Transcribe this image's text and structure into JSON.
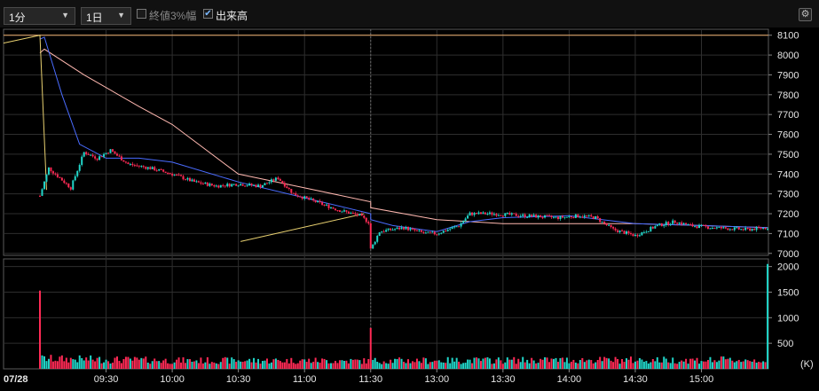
{
  "toolbar": {
    "interval": "1分",
    "period": "1日",
    "limit_label": "終値3%幅",
    "limit_checked": false,
    "volume_label": "出来高",
    "volume_checked": true,
    "gear_icon": "gear-icon"
  },
  "chart_data": {
    "type": "candlestick",
    "date_label": "07/28",
    "price_axis": {
      "ylim": [
        6990,
        8130
      ],
      "ticks": [
        7000,
        7100,
        7200,
        7300,
        7400,
        7500,
        7600,
        7700,
        7800,
        7900,
        8000,
        8100
      ]
    },
    "volume_axis": {
      "ylim": [
        0,
        2150
      ],
      "ticks": [
        500,
        1000,
        1500,
        2000
      ],
      "unit": "(K)"
    },
    "x_ticks": [
      "09:30",
      "10:00",
      "10:30",
      "11:00",
      "11:30",
      "13:00",
      "13:30",
      "14:00",
      "14:30",
      "15:00"
    ],
    "reference_line": 8100,
    "price_keypoints": [
      [
        "09:00",
        7290
      ],
      [
        "09:04",
        7430
      ],
      [
        "09:10",
        7370
      ],
      [
        "09:14",
        7330
      ],
      [
        "09:20",
        7510
      ],
      [
        "09:26",
        7480
      ],
      [
        "09:32",
        7520
      ],
      [
        "09:40",
        7450
      ],
      [
        "09:50",
        7430
      ],
      [
        "10:00",
        7400
      ],
      [
        "10:10",
        7360
      ],
      [
        "10:20",
        7340
      ],
      [
        "10:30",
        7350
      ],
      [
        "10:40",
        7340
      ],
      [
        "10:48",
        7380
      ],
      [
        "10:55",
        7300
      ],
      [
        "11:05",
        7260
      ],
      [
        "11:15",
        7220
      ],
      [
        "11:25",
        7190
      ],
      [
        "11:30",
        7150
      ],
      [
        "12:30",
        7020
      ],
      [
        "12:34",
        7110
      ],
      [
        "12:45",
        7130
      ],
      [
        "12:55",
        7100
      ],
      [
        "13:00",
        7100
      ],
      [
        "13:10",
        7140
      ],
      [
        "13:15",
        7200
      ],
      [
        "13:25",
        7200
      ],
      [
        "13:40",
        7190
      ],
      [
        "13:55",
        7180
      ],
      [
        "14:05",
        7190
      ],
      [
        "14:12",
        7180
      ],
      [
        "14:20",
        7120
      ],
      [
        "14:30",
        7090
      ],
      [
        "14:40",
        7140
      ],
      [
        "14:48",
        7160
      ],
      [
        "14:55",
        7140
      ],
      [
        "15:05",
        7130
      ],
      [
        "15:20",
        7120
      ],
      [
        "15:30",
        7130
      ]
    ],
    "volume_spikes": [
      [
        "09:00",
        1530
      ],
      [
        "12:30",
        800
      ],
      [
        "15:30",
        2050
      ]
    ],
    "volume_base": [
      [
        "09:00",
        210
      ],
      [
        "10:00",
        170
      ],
      [
        "11:00",
        170
      ],
      [
        "11:30",
        160
      ],
      [
        "13:00",
        170
      ],
      [
        "14:00",
        180
      ],
      [
        "15:00",
        180
      ]
    ],
    "ma_short": [
      [
        "09:00",
        8080
      ],
      [
        "09:02",
        8090
      ],
      [
        "09:10",
        7800
      ],
      [
        "09:18",
        7550
      ],
      [
        "09:30",
        7480
      ],
      [
        "09:45",
        7480
      ],
      [
        "10:00",
        7460
      ],
      [
        "10:30",
        7360
      ],
      [
        "11:00",
        7280
      ],
      [
        "11:30",
        7200
      ],
      [
        "12:30",
        7170
      ],
      [
        "12:40",
        7140
      ],
      [
        "13:00",
        7110
      ],
      [
        "13:15",
        7160
      ],
      [
        "13:30",
        7180
      ],
      [
        "14:00",
        7190
      ],
      [
        "14:30",
        7150
      ],
      [
        "15:00",
        7140
      ],
      [
        "15:30",
        7130
      ]
    ],
    "ma_long": [
      [
        "09:00",
        8010
      ],
      [
        "09:02",
        8030
      ],
      [
        "09:20",
        7900
      ],
      [
        "09:45",
        7740
      ],
      [
        "10:00",
        7650
      ],
      [
        "10:30",
        7400
      ],
      [
        "11:00",
        7330
      ],
      [
        "11:30",
        7260
      ],
      [
        "12:30",
        7230
      ],
      [
        "13:00",
        7170
      ],
      [
        "13:30",
        7150
      ],
      [
        "14:00",
        7150
      ],
      [
        "14:30",
        7150
      ],
      [
        "15:00",
        7140
      ],
      [
        "15:30",
        7130
      ]
    ],
    "colors": {
      "up": "#21d6c9",
      "down": "#ff2a55",
      "ma_short": "#4a6cff",
      "ma_long": "#ffb8b0",
      "ref_line": "#f0b070",
      "grid": "#2e2e2e",
      "border": "#5a5a5a"
    }
  }
}
